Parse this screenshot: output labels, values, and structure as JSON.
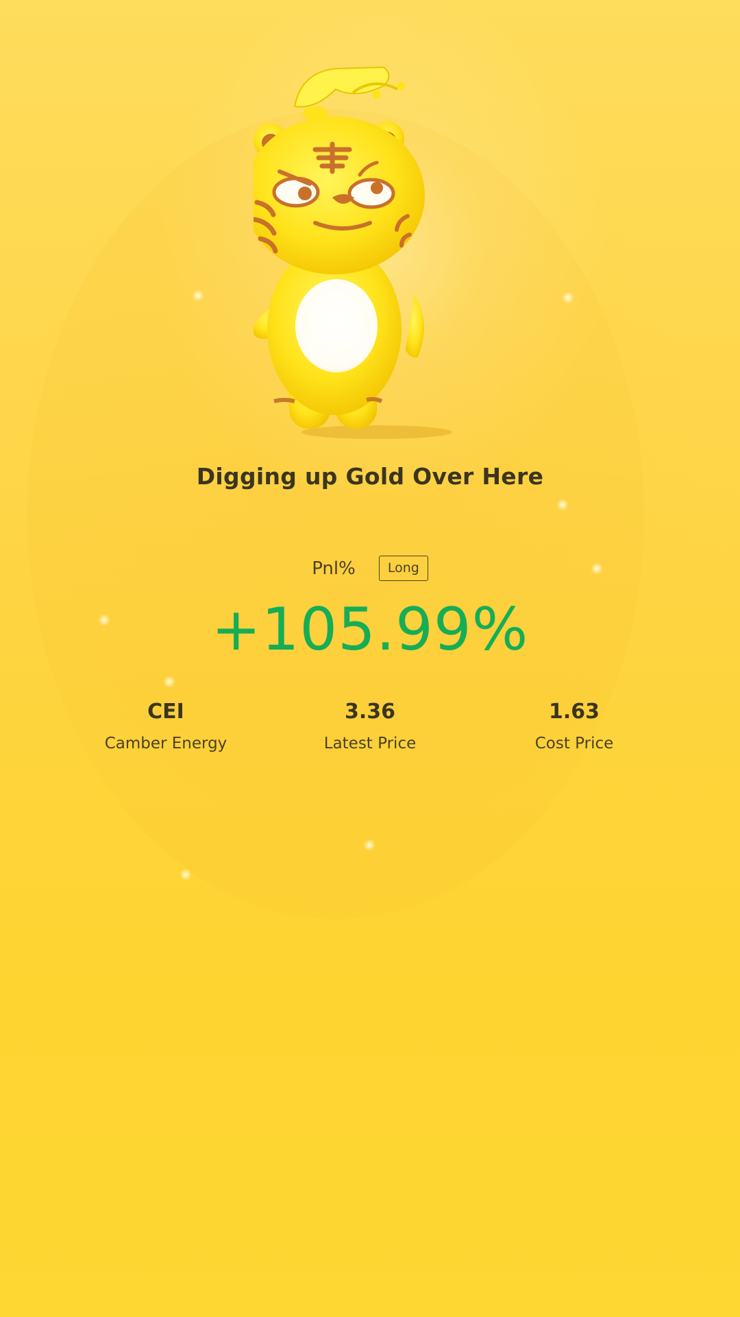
{
  "headline": "Digging up Gold Over Here",
  "pnl": {
    "label": "Pnl%",
    "direction": "Long",
    "value": "+105.99%",
    "color": "#15ad55"
  },
  "stats": {
    "symbol": {
      "value": "CEI",
      "label": "Camber Energy"
    },
    "latest_price": {
      "value": "3.36",
      "label": "Latest Price"
    },
    "cost_price": {
      "value": "1.63",
      "label": "Cost Price"
    }
  },
  "colors": {
    "background": "#fed442",
    "text": "#3b3520"
  },
  "icons": {
    "mascot": "tiger-mascot-illustration"
  }
}
